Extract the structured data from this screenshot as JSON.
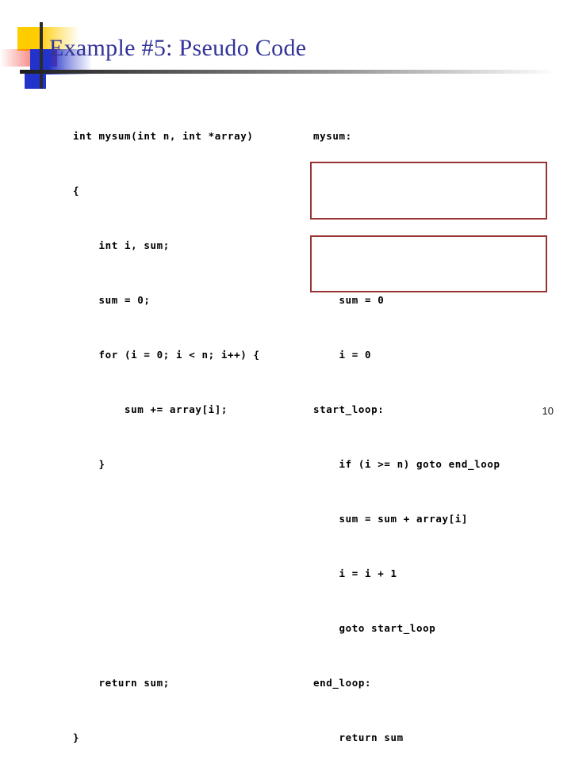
{
  "slide": {
    "title": "Example #5: Pseudo Code",
    "page_number": "10",
    "background_color": "#ffffff",
    "title_color": "#333399",
    "highlight_border_color": "#993333",
    "logo": {
      "yellow": "#ffcc00",
      "red": "#ee2222",
      "blue": "#2233cc",
      "cross_line": "#2b2b2b"
    }
  },
  "code_left": {
    "language_style": "c",
    "lines": [
      "int mysum(int n, int *array)",
      "{",
      "    int i, sum;",
      "    sum = 0;",
      "    for (i = 0; i < n; i++) {",
      "        sum += array[i];",
      "    }",
      "",
      "",
      "",
      "    return sum;",
      "}"
    ]
  },
  "code_right": {
    "language_style": "pseudo-assembly",
    "lines": [
      "mysum:",
      "",
      "",
      "    sum = 0",
      "    i = 0",
      "start_loop:",
      "    if (i >= n) goto end_loop",
      "    sum = sum + array[i]",
      "    i = i + 1",
      "    goto start_loop",
      "end_loop:",
      "    return sum"
    ]
  },
  "highlight_boxes": [
    {
      "label": "loop-entry-test-box",
      "lines": [
        "i = 0",
        "start_loop:",
        "if (i >= n) goto end_loop"
      ]
    },
    {
      "label": "loop-increment-exit-box",
      "lines": [
        "i = i + 1",
        "goto start_loop",
        "end_loop:"
      ]
    }
  ]
}
